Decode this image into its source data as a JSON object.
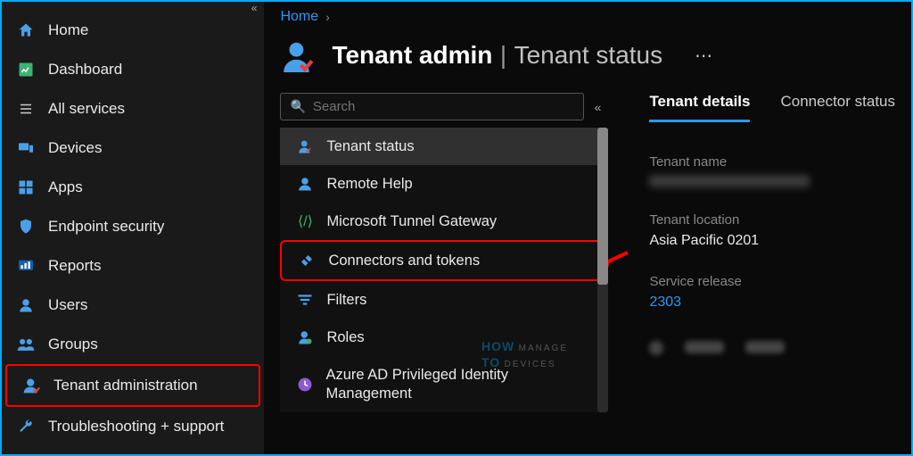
{
  "leftnav": {
    "items": [
      {
        "label": "Home",
        "icon": "home"
      },
      {
        "label": "Dashboard",
        "icon": "dashboard"
      },
      {
        "label": "All services",
        "icon": "list"
      },
      {
        "label": "Devices",
        "icon": "devices"
      },
      {
        "label": "Apps",
        "icon": "apps"
      },
      {
        "label": "Endpoint security",
        "icon": "shield"
      },
      {
        "label": "Reports",
        "icon": "reports"
      },
      {
        "label": "Users",
        "icon": "user"
      },
      {
        "label": "Groups",
        "icon": "groups"
      },
      {
        "label": "Tenant administration",
        "icon": "tenant",
        "highlight": true
      },
      {
        "label": "Troubleshooting + support",
        "icon": "wrench"
      }
    ]
  },
  "breadcrumb": {
    "home": "Home"
  },
  "header": {
    "title": "Tenant admin",
    "subtitle": "Tenant status"
  },
  "search": {
    "placeholder": "Search"
  },
  "menu": {
    "items": [
      {
        "label": "Tenant status",
        "icon": "tenant",
        "selected": true
      },
      {
        "label": "Remote Help",
        "icon": "user"
      },
      {
        "label": "Microsoft Tunnel Gateway",
        "icon": "tunnel"
      },
      {
        "label": "Connectors and tokens",
        "icon": "connector",
        "highlight": true
      },
      {
        "label": "Filters",
        "icon": "filter"
      },
      {
        "label": "Roles",
        "icon": "roles"
      },
      {
        "label": "Azure AD Privileged Identity Management",
        "icon": "pim"
      }
    ]
  },
  "tabs": [
    {
      "label": "Tenant details",
      "active": true
    },
    {
      "label": "Connector status",
      "active": false
    }
  ],
  "details": {
    "tenant_name_label": "Tenant name",
    "tenant_location_label": "Tenant location",
    "tenant_location_value": "Asia Pacific 0201",
    "service_release_label": "Service release",
    "service_release_value": "2303"
  },
  "watermark": {
    "line1": "HOW",
    "line2": "TO",
    "line3": "MANAGE",
    "line4": "DEVICES"
  }
}
